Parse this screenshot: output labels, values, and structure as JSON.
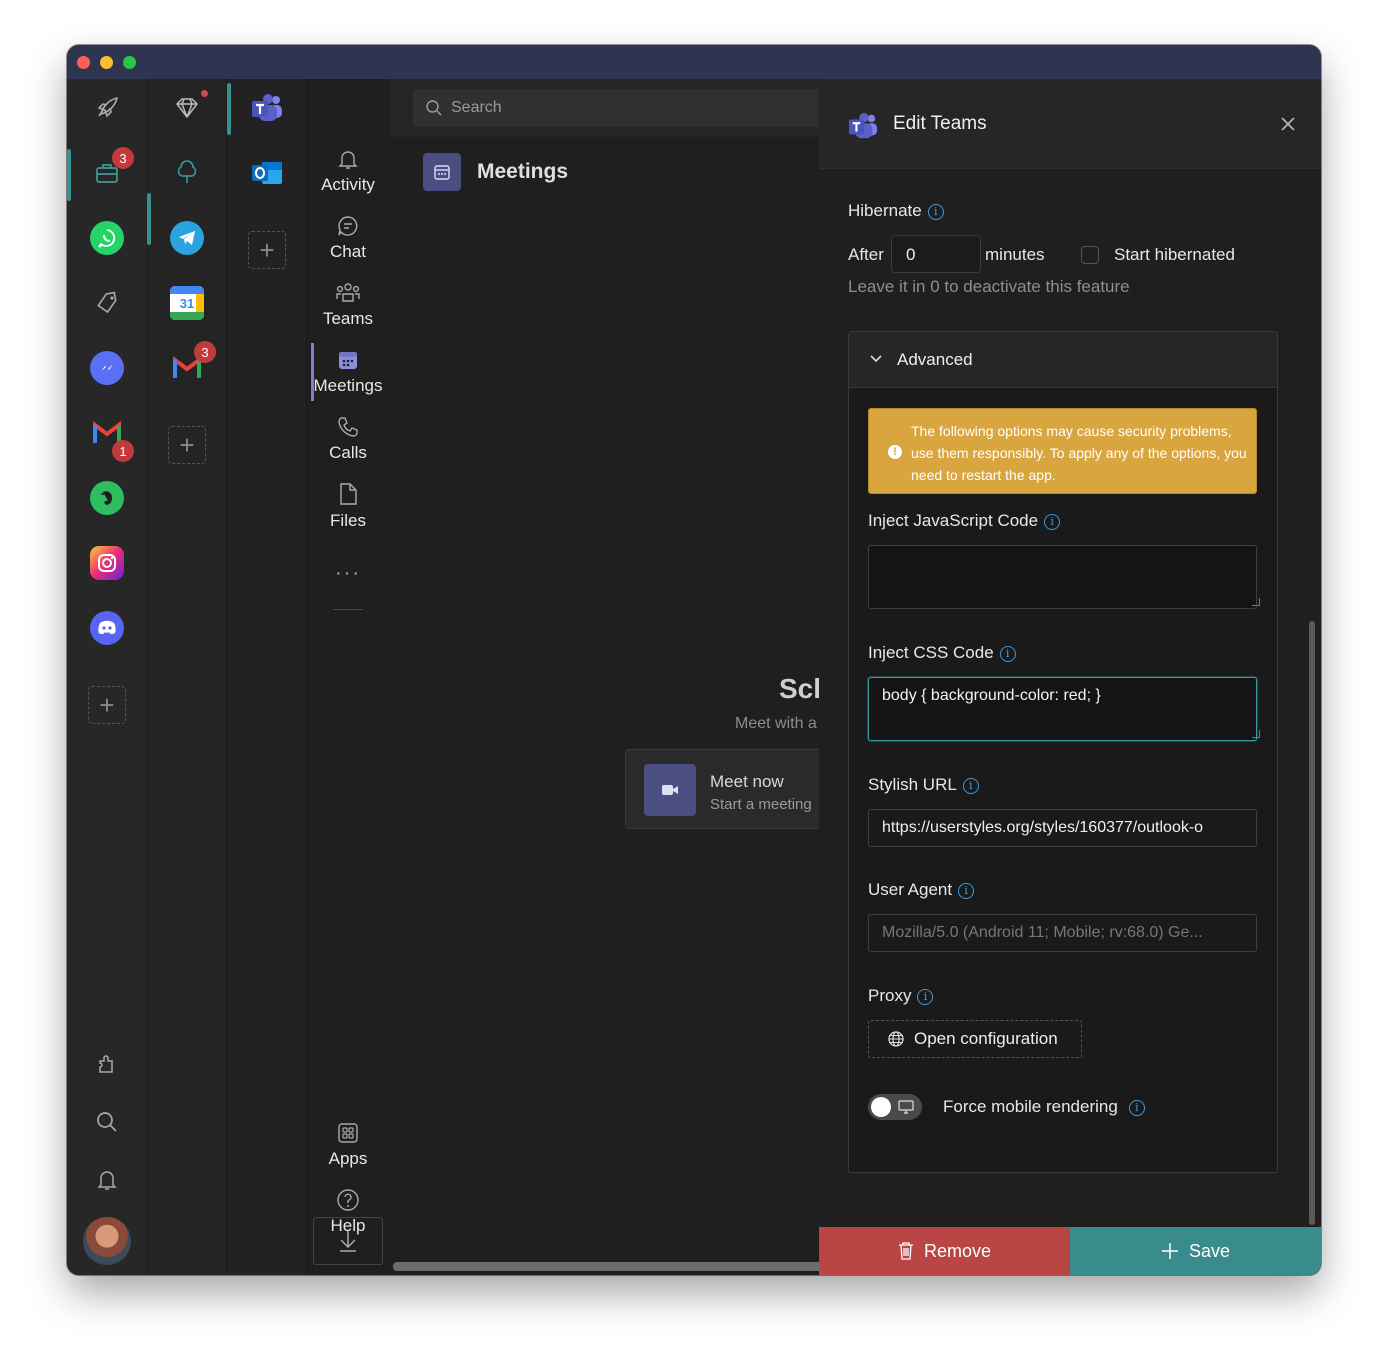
{
  "window": {
    "controls": [
      "close",
      "minimize",
      "zoom"
    ]
  },
  "rail1": {
    "items": [
      {
        "icon": "rocket-icon"
      },
      {
        "icon": "briefcase-icon",
        "badge": "3"
      },
      {
        "icon": "whatsapp-icon",
        "color": "#25d366"
      },
      {
        "icon": "tag-icon"
      },
      {
        "icon": "messenger-icon",
        "color": "#5b6ff5"
      },
      {
        "icon": "gmail-icon",
        "badge": "1"
      },
      {
        "icon": "evernote-icon",
        "color": "#2dbe60"
      },
      {
        "icon": "instagram-icon",
        "color": "#e1306c"
      },
      {
        "icon": "discord-icon",
        "color": "#5865f2"
      }
    ],
    "bottom": [
      "extension-icon",
      "search-icon",
      "bell-icon",
      "avatar"
    ]
  },
  "rail2": {
    "items": [
      {
        "icon": "diamond-icon"
      },
      {
        "icon": "tree-icon"
      },
      {
        "icon": "telegram-icon",
        "color": "#2aa3df"
      },
      {
        "icon": "google-calendar-icon",
        "label": "31"
      },
      {
        "icon": "gmail-icon",
        "badge": "3"
      }
    ]
  },
  "rail3": {
    "items": [
      {
        "icon": "teams-icon",
        "color": "#5b5fc7"
      },
      {
        "icon": "outlook-icon",
        "color": "#0f6cbd"
      }
    ]
  },
  "teams_nav": {
    "items": [
      {
        "label": "Activity",
        "icon": "bell-icon"
      },
      {
        "label": "Chat",
        "icon": "chat-icon"
      },
      {
        "label": "Teams",
        "icon": "teams-people-icon"
      },
      {
        "label": "Meetings",
        "icon": "calendar-icon",
        "active": true
      },
      {
        "label": "Calls",
        "icon": "phone-icon"
      },
      {
        "label": "Files",
        "icon": "file-icon"
      }
    ],
    "more": "···",
    "apps_label": "Apps",
    "help_label": "Help"
  },
  "main": {
    "search_placeholder": "Search",
    "title": "Meetings",
    "schedule_heading": "Sch",
    "schedule_sub": "Meet with a",
    "meet_now": {
      "title": "Meet now",
      "subtitle": "Start a meeting"
    }
  },
  "panel": {
    "title": "Edit Teams",
    "hibernate": {
      "label": "Hibernate",
      "after_label": "After",
      "after_value": "0",
      "minutes_label": "minutes",
      "start_hibernated_label": "Start hibernated",
      "hint": "Leave it in 0 to deactivate this feature"
    },
    "advanced": {
      "label": "Advanced",
      "warning": "The following options may cause security problems, use them responsibly. To apply any of the options, you need to restart the app.",
      "inject_js_label": "Inject JavaScript Code",
      "inject_js_value": "",
      "inject_css_label": "Inject CSS Code",
      "inject_css_value": "body { background-color: red; }",
      "stylish_label": "Stylish URL",
      "stylish_value": "https://userstyles.org/styles/160377/outlook-o",
      "user_agent_label": "User Agent",
      "user_agent_placeholder": "Mozilla/5.0 (Android 11; Mobile; rv:68.0) Ge...",
      "proxy_label": "Proxy",
      "proxy_button": "Open configuration",
      "force_mobile_label": "Force mobile rendering"
    },
    "remove_label": "Remove",
    "save_label": "Save"
  },
  "colors": {
    "accent": "#3a8c8c",
    "danger": "#b94545",
    "warning": "#d9a53f",
    "info": "#3a9be0",
    "teams": "#5b5fc7"
  }
}
